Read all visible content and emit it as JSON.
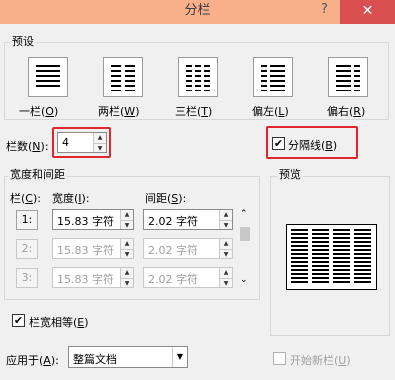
{
  "window": {
    "title": "分栏",
    "help": "?",
    "close": "✕"
  },
  "presets": {
    "label": "预设",
    "items": [
      {
        "label": "一栏(",
        "key": "O",
        "suffix": ")"
      },
      {
        "label": "两栏(",
        "key": "W",
        "suffix": ")"
      },
      {
        "label": "三栏(",
        "key": "T",
        "suffix": ")"
      },
      {
        "label": "偏左(",
        "key": "L",
        "suffix": ")"
      },
      {
        "label": "偏右(",
        "key": "R",
        "suffix": ")"
      }
    ]
  },
  "columns": {
    "label": "栏数(",
    "key": "N",
    "suffix": "):",
    "value": "4"
  },
  "separator": {
    "checked": true,
    "label": "分隔线(",
    "key": "B",
    "suffix": ")"
  },
  "width_spacing": {
    "label": "宽度和间距",
    "col_header": {
      "label": "栏(",
      "key": "C",
      "suffix": "):"
    },
    "width_header": {
      "label": "宽度(",
      "key": "I",
      "suffix": "):"
    },
    "spacing_header": {
      "label": "间距(",
      "key": "S",
      "suffix": "):"
    },
    "rows": [
      {
        "num": "1:",
        "width": "15.83 字符",
        "spacing": "2.02 字符",
        "enabled": true
      },
      {
        "num": "2:",
        "width": "15.83 字符",
        "spacing": "2.02 字符",
        "enabled": false
      },
      {
        "num": "3:",
        "width": "15.83 字符",
        "spacing": "2.02 字符",
        "enabled": false
      }
    ]
  },
  "equal_width": {
    "checked": true,
    "label": "栏宽相等(",
    "key": "E",
    "suffix": ")"
  },
  "preview": {
    "label": "预览",
    "column_count": 4
  },
  "apply_to": {
    "label": "应用于(",
    "key": "A",
    "suffix": "):",
    "value": "整篇文档"
  },
  "new_column": {
    "checked": false,
    "label": "开始新栏(",
    "key": "U",
    "suffix": ")"
  },
  "colors": {
    "accent": "#f7b08a",
    "close": "#d94f4f",
    "highlight": "#e1272e"
  }
}
